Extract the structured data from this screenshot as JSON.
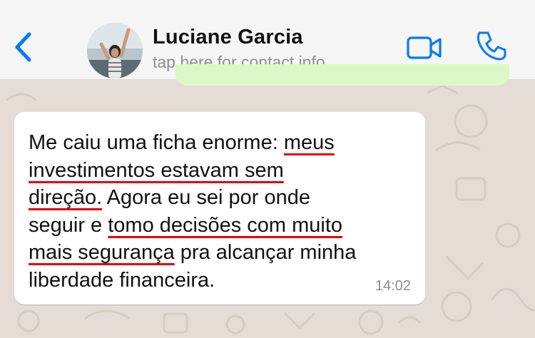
{
  "header": {
    "contact_name": "Luciane Garcia",
    "subtitle": "tap here for contact info",
    "back_icon": "chevron-left-icon",
    "video_icon": "video-camera-icon",
    "call_icon": "phone-icon"
  },
  "message": {
    "lines": [
      [
        {
          "t": "Me caiu uma ficha enorme: ",
          "u": false
        },
        {
          "t": "meus",
          "u": true
        }
      ],
      [
        {
          "t": "investimentos estavam sem",
          "u": true
        }
      ],
      [
        {
          "t": "direção.",
          "u": true
        },
        {
          "t": " Agora eu sei por onde",
          "u": false
        }
      ],
      [
        {
          "t": "seguir e ",
          "u": false
        },
        {
          "t": "tomo decisões com muito",
          "u": true
        }
      ],
      [
        {
          "t": "mais segurança",
          "u": true
        },
        {
          "t": " pra alcançar minha",
          "u": false
        }
      ],
      [
        {
          "t": "liberdade financeira.",
          "u": false
        }
      ]
    ],
    "time": "14:02"
  },
  "colors": {
    "accent": "#007aff",
    "underline": "#e60000",
    "header_bg": "#f6f6f6",
    "chat_bg": "#e5ddd5",
    "outgoing_bubble": "#dcf8c6"
  }
}
